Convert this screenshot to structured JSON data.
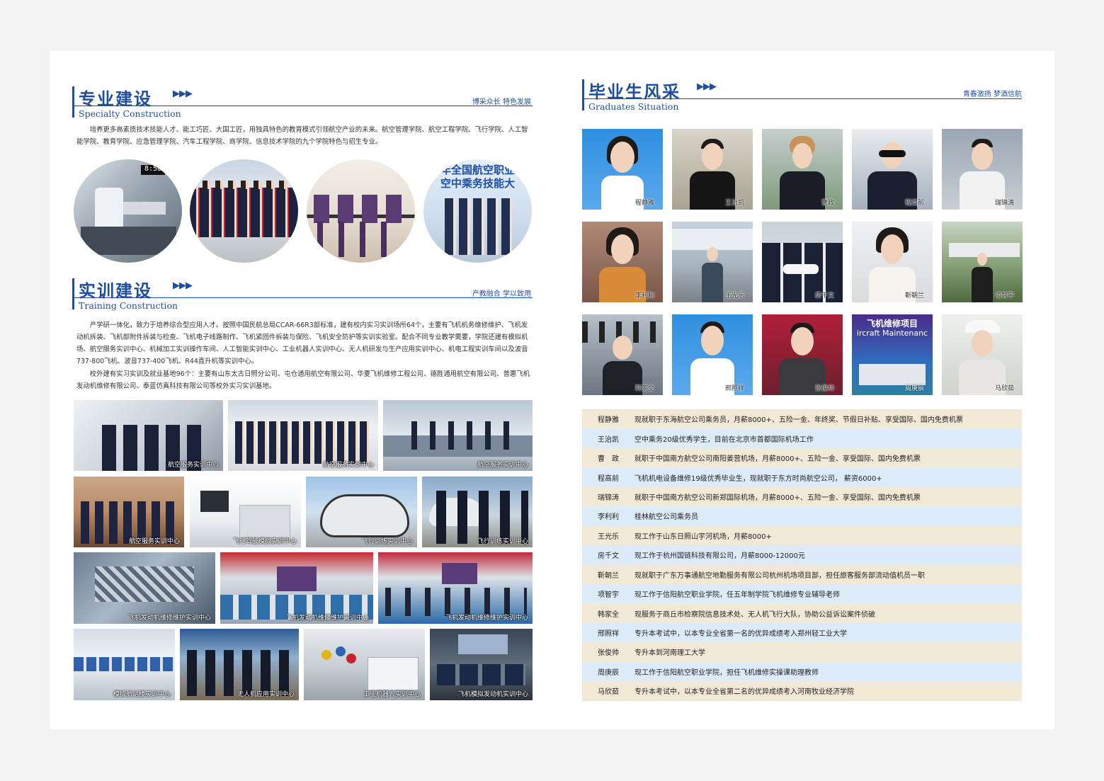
{
  "specialty": {
    "title": "专业建设",
    "en": "Specialty Construction",
    "slogan": "博采众长  特色发展",
    "text": "培养更多高素质技术技能人才、能工巧匠、大国工匠，用独具特色的教育模式引领航空产业的未来。航空管理学院、航空工程学院、飞行学院、人工智能学院、教育学院、应急管理学院、汽车工程学院、商学院、信息技术学院的九个学院特色与招生专业。",
    "banner_text": "年全国航空职业\n空中乘务技能大"
  },
  "training": {
    "title": "实训建设",
    "en": "Training Construction",
    "slogan": "产教融合  学以致用",
    "text1": "产学研一体化，致力于培养综合型应用人才。按照中国民航总局CCAR-66R3部标准，建有校内实习实训场所64个，主要有飞机机务维修维护、飞机发动机拆装、飞机部附件拆装与检查、飞机电子线路制作、飞机紧固件拆装与保险、飞机安全防护等实训实验室。配合不同专业教学需要，学院还建有模拟机场、航空服务实训中心、机械加工实训操作车间、人工智能实训中心、工业机器人实训中心、无人机研发与生产应用实训中心、机电工程实训车间以及波音737-800飞机、波音737-400飞机、R44直升机等实训中心。",
    "text2": "校外建有实习实训及就业基地96个：主要有山东太古日照分公司、屯仓通用航空有限公司、华夏飞机维修工程公司、德胜通用航空有限公司、普惠飞机发动机维修有限公司、泰蓝仿真科技有限公司等校外实习实训基地。",
    "captions": [
      "航空服务实训中心",
      "航空服务实训中心",
      "航空服务实训中心",
      "航空服务实训中心",
      "飞行驾驶模拟实训中心",
      "飞行训练实训中心",
      "飞行训练实训中心",
      "飞机发动机维修维护实训中心",
      "飞机发动机维修维护实训中心",
      "飞机发动机维修维护实训中心",
      "模拟航站楼实训中心",
      "无人机应用实训中心",
      "工业机器人实训中心",
      "飞机模拟发动机实训中心"
    ]
  },
  "graduates": {
    "title": "毕业生风采",
    "en": "Graduates Situation",
    "slogan": "青春激扬  梦酒信航",
    "thumb_names": [
      "程静雅",
      "王治凯",
      "曹政",
      "程高前",
      "瑞锦涛",
      "李利利",
      "王光乐",
      "房千文",
      "靳朝兰",
      "项智宇",
      "韩家全",
      "邢照祥",
      "张俊帅",
      "周庚辰",
      "马欣茹"
    ],
    "banner_repair": "飞机维修项目",
    "banner_repair_en": "ircraft Maintenanc",
    "rows": [
      {
        "name": "程静雅",
        "text": "现就职于东海航空公司乘务员，月薪8000+、五险一金、年终奖、节假日补贴、享受国际、国内免费机票"
      },
      {
        "name": "王治凯",
        "text": "空中乘务20级优秀学生，目前在北京市首都国际机场工作"
      },
      {
        "name": "曹　政",
        "text": "就职于中国南方航空公司南阳姜营机场，月薪8000+、五险一金、享受国际、国内免费机票"
      },
      {
        "name": "程高前",
        "text": "飞机机电设备维修19级优秀毕业生，现就职于东方时尚航空公司， 薪资6000+"
      },
      {
        "name": "瑞锦涛",
        "text": "就职于中国南方航空公司新郑国际机场，月薪8000+、五险一金、享受国际、国内免费机票"
      },
      {
        "name": "李利利",
        "text": "桂林航空公司乘务员"
      },
      {
        "name": "王光乐",
        "text": "现工作于山东日照山宇河机场，月薪8000+"
      },
      {
        "name": "房千文",
        "text": "现工作于杭州国链科技有限公司，月薪8000-12000元"
      },
      {
        "name": "靳朝兰",
        "text": "现就职于广东万事通航空地勤服务有限公司杭州机场项目部，担任旅客服务部流动值机员一职"
      },
      {
        "name": "项智宇",
        "text": "现工作于信阳航空职业学院，任五年制学院飞机维修专业辅导老师"
      },
      {
        "name": "韩家全",
        "text": "现服务于商丘市检察院信息技术处、无人机飞行大队，协助公益诉讼案件侦破"
      },
      {
        "name": "邢照祥",
        "text": "专升本考试中，以本专业全省第一名的优异成绩考入郑州轻工业大学"
      },
      {
        "name": "张俊帅",
        "text": "专升本到河南理工大学"
      },
      {
        "name": "周庚辰",
        "text": "现工作于信阳航空职业学院，担任飞机维修实操课助理教师"
      },
      {
        "name": "马欣茹",
        "text": "专升本考试中，以本专业全省第二名的优异成绩考入河南牧业经济学院"
      }
    ]
  },
  "colors": {
    "brand_blue": "#1f4f9c",
    "row_tan": "#f2e8d6",
    "row_blue": "#dcebf7"
  }
}
